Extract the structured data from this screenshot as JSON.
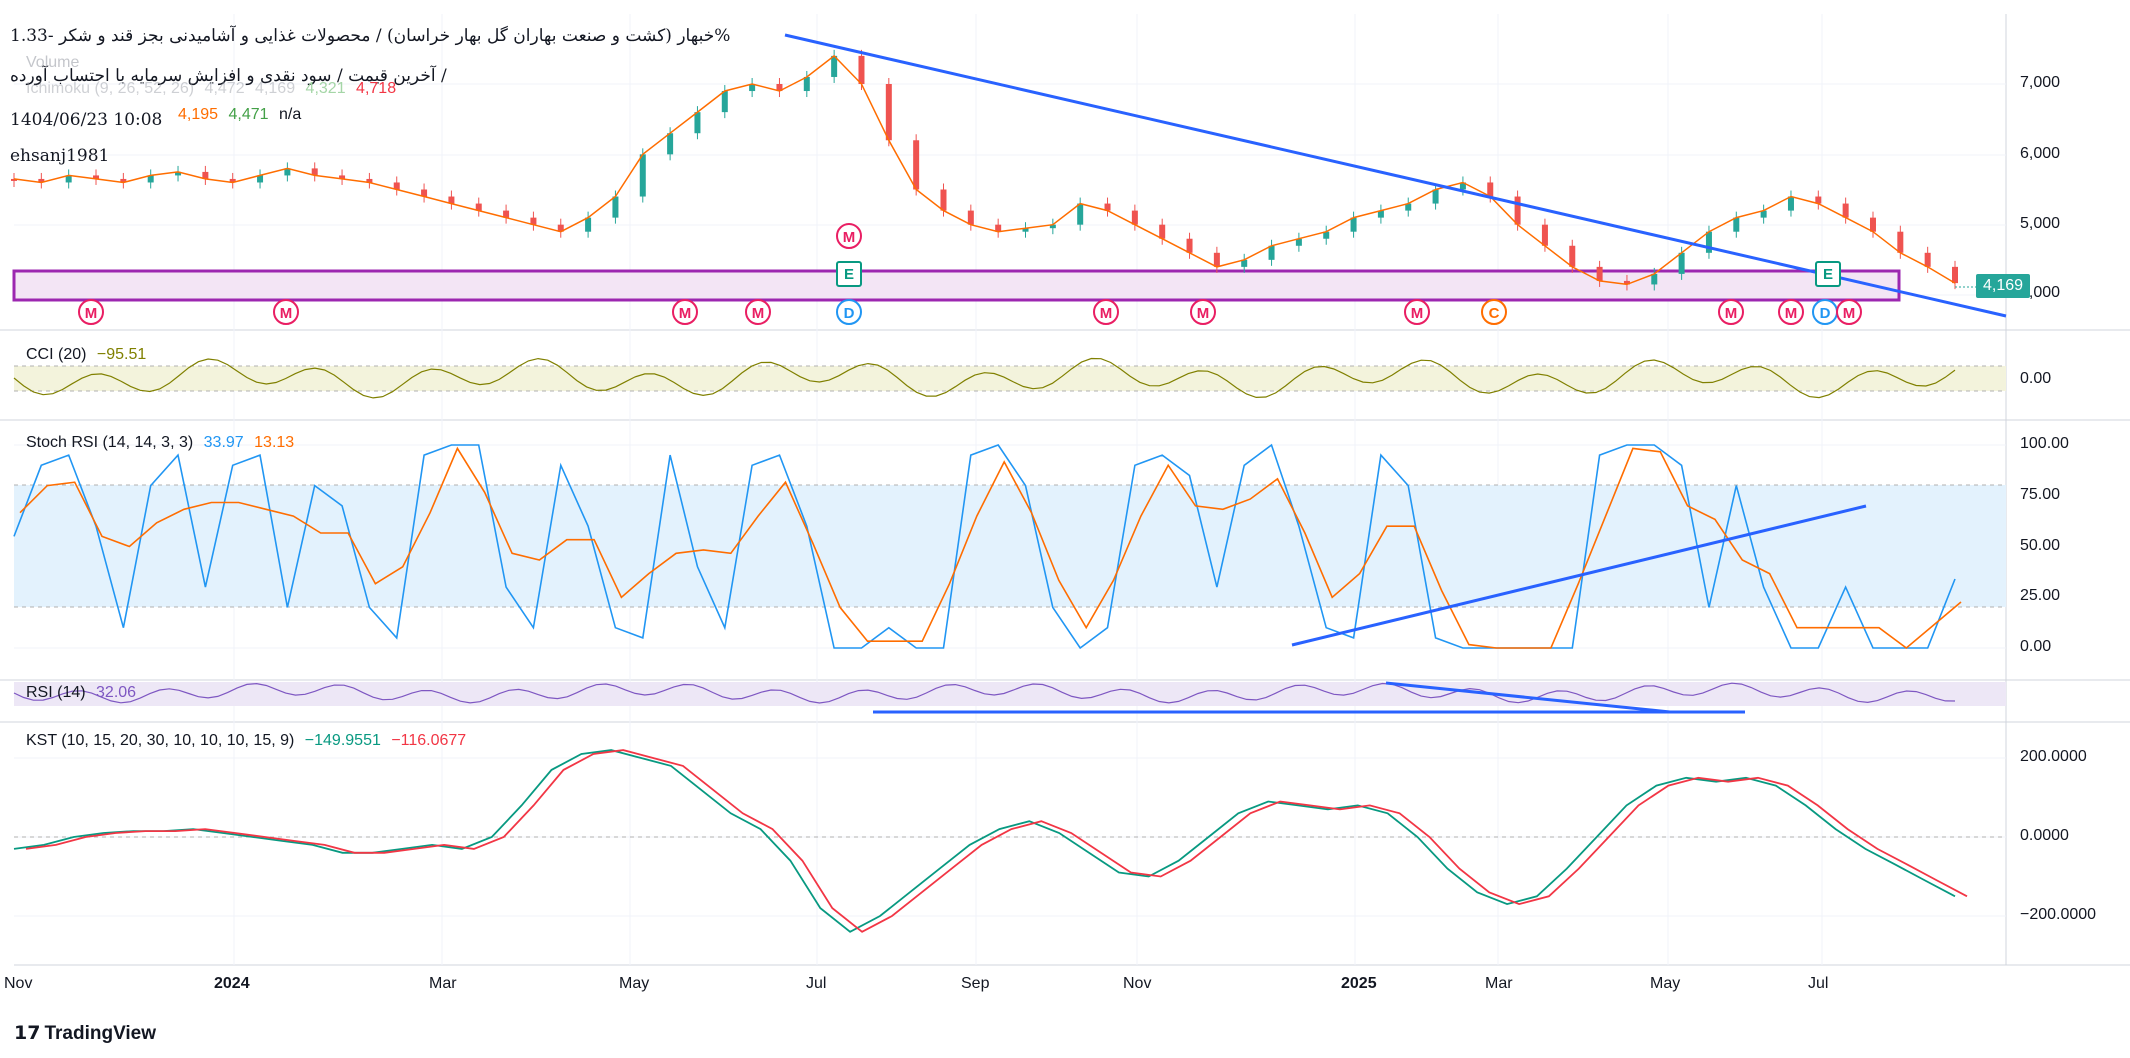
{
  "header": {
    "title_line": "خبهار (کشت و صنعت بهاران گل بهار خراسان) / محصولات غذایی و آشامیدنی بجز قند و شکر",
    "change_pct": "-1.33%",
    "subtitle": "آخرین قیمت / سود نقدی و افزایش سرمایه با احتساب آورده /",
    "timestamp": "1404/06/23 10:08",
    "author": "ehsanj1981"
  },
  "legends": {
    "volume_label": "Volume",
    "ichimoku_label": "Ichimoku (9, 26, 52, 26)",
    "ichimoku_vals": [
      "4,472",
      "4,169",
      "4,321",
      "4,718"
    ],
    "ichimoku_vals2": [
      "4,195",
      "4,471",
      "n/a"
    ],
    "cci_label": "CCI (20)",
    "cci_val": "−95.51",
    "stoch_label": "Stoch RSI (14, 14, 3, 3)",
    "stoch_k": "33.97",
    "stoch_d": "13.13",
    "rsi_label": "RSI (14)",
    "rsi_val": "32.06",
    "kst_label": "KST (10, 15, 20, 30, 10, 10, 10, 15, 9)",
    "kst_val": "−149.9551",
    "kst_signal": "−116.0677"
  },
  "price_tag": "4,169",
  "brand": "TradingView",
  "colors": {
    "up": "#26a69a",
    "down": "#ef5350",
    "trendline": "#2962ff",
    "stoch_k": "#2196f3",
    "stoch_d": "#ff6d00",
    "rsi": "#7e57c2",
    "kst": "#089981",
    "kst_signal": "#f23645",
    "cci": "#808000",
    "box": "#9c27b0"
  },
  "chart_data": {
    "type": "line",
    "x_ticks": [
      "Nov",
      "2024",
      "Mar",
      "May",
      "Jul",
      "Sep",
      "Nov",
      "2025",
      "Mar",
      "May",
      "Jul"
    ],
    "price_axis": {
      "ticks": [
        "7,000",
        "6,000",
        "5,000",
        "4,000"
      ],
      "values": [
        7000,
        6000,
        5000,
        4000
      ],
      "ylim": [
        3700,
        7800
      ]
    },
    "cci_axis": {
      "ticks": [
        "0.00"
      ]
    },
    "stoch_axis": {
      "ticks": [
        "100.00",
        "75.00",
        "50.00",
        "25.00",
        "0.00"
      ],
      "ylim": [
        0,
        100
      ]
    },
    "kst_axis": {
      "ticks": [
        "200.0000",
        "0.0000",
        "−200.0000"
      ],
      "ylim": [
        -260,
        260
      ]
    },
    "price": [
      5650,
      5600,
      5700,
      5650,
      5600,
      5700,
      5750,
      5650,
      5600,
      5700,
      5800,
      5700,
      5650,
      5600,
      5500,
      5400,
      5300,
      5200,
      5100,
      5000,
      4900,
      5100,
      5400,
      6000,
      6300,
      6600,
      6900,
      7000,
      6900,
      7100,
      7400,
      7000,
      6200,
      5500,
      5200,
      5000,
      4900,
      4950,
      5000,
      5300,
      5200,
      5000,
      4800,
      4600,
      4400,
      4500,
      4700,
      4800,
      4900,
      5100,
      5200,
      5300,
      5500,
      5600,
      5400,
      5000,
      4700,
      4400,
      4200,
      4150,
      4300,
      4600,
      4900,
      5100,
      5200,
      5400,
      5300,
      5100,
      4900,
      4600,
      4400,
      4169
    ],
    "stoch_k": [
      55,
      90,
      95,
      60,
      10,
      80,
      95,
      30,
      90,
      95,
      20,
      80,
      70,
      20,
      5,
      95,
      100,
      100,
      30,
      10,
      90,
      60,
      10,
      5,
      95,
      40,
      10,
      90,
      95,
      60,
      0,
      0,
      10,
      0,
      0,
      95,
      100,
      80,
      20,
      0,
      10,
      90,
      95,
      85,
      30,
      90,
      100,
      60,
      10,
      5,
      95,
      80,
      5,
      0,
      0,
      0,
      0,
      0,
      95,
      100,
      100,
      90,
      20,
      80,
      30,
      0,
      0,
      30,
      0,
      0,
      0,
      34
    ],
    "kst": [
      -30,
      -20,
      0,
      10,
      15,
      15,
      20,
      10,
      0,
      -10,
      -20,
      -40,
      -40,
      -30,
      -20,
      -30,
      0,
      80,
      170,
      210,
      220,
      200,
      180,
      120,
      60,
      20,
      -60,
      -180,
      -240,
      -200,
      -140,
      -80,
      -20,
      20,
      40,
      10,
      -40,
      -90,
      -100,
      -60,
      0,
      60,
      90,
      80,
      70,
      80,
      60,
      0,
      -80,
      -140,
      -170,
      -150,
      -80,
      0,
      80,
      130,
      150,
      140,
      150,
      130,
      80,
      20,
      -30,
      -70,
      -110,
      -150
    ]
  },
  "markers": {
    "m": "M",
    "d": "D",
    "c": "C",
    "e": "E"
  }
}
